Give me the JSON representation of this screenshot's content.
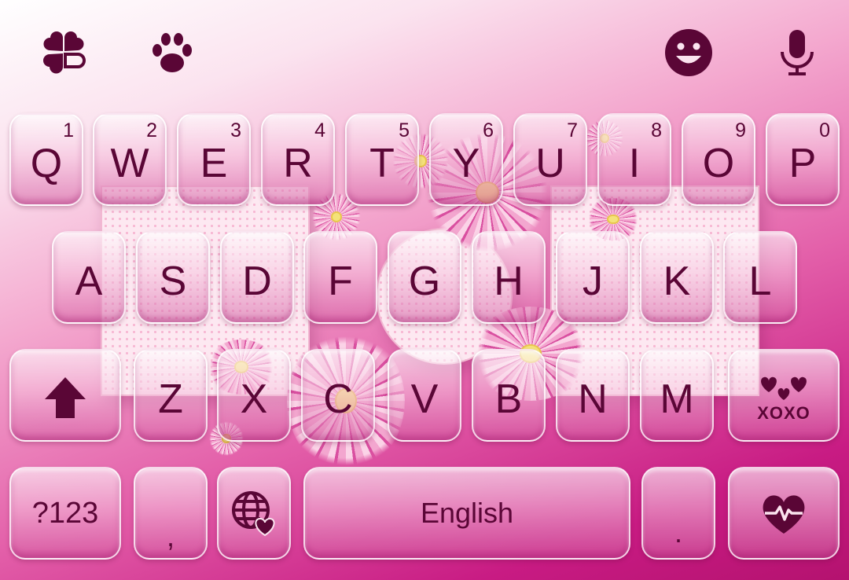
{
  "toolbar": {
    "left_icons": [
      "clover-app-icon",
      "paw-sticker-icon"
    ],
    "right_icons": [
      "emoji-smile-icon",
      "microphone-icon"
    ]
  },
  "colors": {
    "key_text": "#5a0636",
    "accent": "#c81b83",
    "background_light": "#fbe3ef"
  },
  "keyboard": {
    "row1": [
      {
        "label": "Q",
        "hint": "1"
      },
      {
        "label": "W",
        "hint": "2"
      },
      {
        "label": "E",
        "hint": "3"
      },
      {
        "label": "R",
        "hint": "4"
      },
      {
        "label": "T",
        "hint": "5"
      },
      {
        "label": "Y",
        "hint": "6"
      },
      {
        "label": "U",
        "hint": "7"
      },
      {
        "label": "I",
        "hint": "8"
      },
      {
        "label": "O",
        "hint": "9"
      },
      {
        "label": "P",
        "hint": "0"
      }
    ],
    "row2": [
      "A",
      "S",
      "D",
      "F",
      "G",
      "H",
      "J",
      "K",
      "L"
    ],
    "row3": [
      "Z",
      "X",
      "C",
      "V",
      "B",
      "N",
      "M"
    ],
    "shift_icon": "shift-arrow-icon",
    "xoxo_label": "XOXO",
    "symbols_label": "?123",
    "comma_label": ",",
    "language_icon": "globe-heart-icon",
    "space_label": "English",
    "period_label": ".",
    "enter_icon": "heartbeat-icon"
  }
}
